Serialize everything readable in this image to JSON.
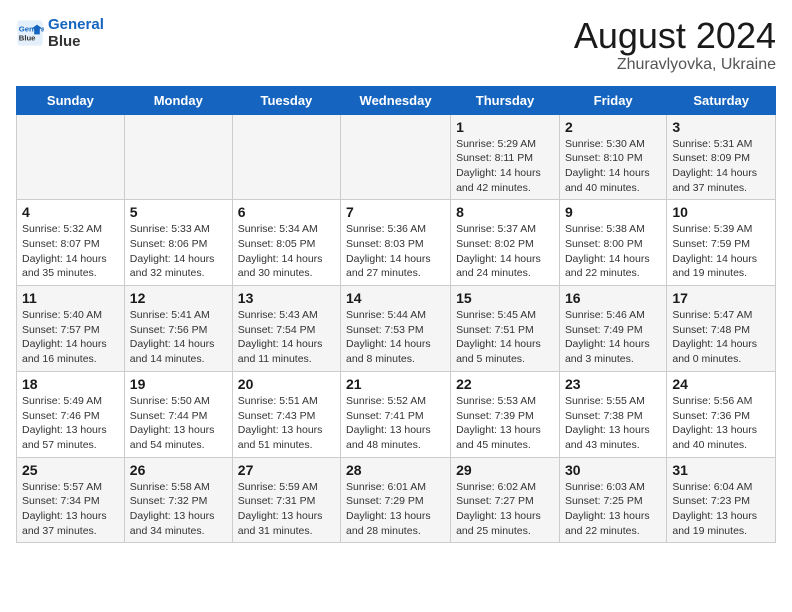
{
  "header": {
    "logo_line1": "General",
    "logo_line2": "Blue",
    "month": "August 2024",
    "location": "Zhuravlyovka, Ukraine"
  },
  "weekdays": [
    "Sunday",
    "Monday",
    "Tuesday",
    "Wednesday",
    "Thursday",
    "Friday",
    "Saturday"
  ],
  "weeks": [
    [
      {
        "day": "",
        "info": ""
      },
      {
        "day": "",
        "info": ""
      },
      {
        "day": "",
        "info": ""
      },
      {
        "day": "",
        "info": ""
      },
      {
        "day": "1",
        "info": "Sunrise: 5:29 AM\nSunset: 8:11 PM\nDaylight: 14 hours\nand 42 minutes."
      },
      {
        "day": "2",
        "info": "Sunrise: 5:30 AM\nSunset: 8:10 PM\nDaylight: 14 hours\nand 40 minutes."
      },
      {
        "day": "3",
        "info": "Sunrise: 5:31 AM\nSunset: 8:09 PM\nDaylight: 14 hours\nand 37 minutes."
      }
    ],
    [
      {
        "day": "4",
        "info": "Sunrise: 5:32 AM\nSunset: 8:07 PM\nDaylight: 14 hours\nand 35 minutes."
      },
      {
        "day": "5",
        "info": "Sunrise: 5:33 AM\nSunset: 8:06 PM\nDaylight: 14 hours\nand 32 minutes."
      },
      {
        "day": "6",
        "info": "Sunrise: 5:34 AM\nSunset: 8:05 PM\nDaylight: 14 hours\nand 30 minutes."
      },
      {
        "day": "7",
        "info": "Sunrise: 5:36 AM\nSunset: 8:03 PM\nDaylight: 14 hours\nand 27 minutes."
      },
      {
        "day": "8",
        "info": "Sunrise: 5:37 AM\nSunset: 8:02 PM\nDaylight: 14 hours\nand 24 minutes."
      },
      {
        "day": "9",
        "info": "Sunrise: 5:38 AM\nSunset: 8:00 PM\nDaylight: 14 hours\nand 22 minutes."
      },
      {
        "day": "10",
        "info": "Sunrise: 5:39 AM\nSunset: 7:59 PM\nDaylight: 14 hours\nand 19 minutes."
      }
    ],
    [
      {
        "day": "11",
        "info": "Sunrise: 5:40 AM\nSunset: 7:57 PM\nDaylight: 14 hours\nand 16 minutes."
      },
      {
        "day": "12",
        "info": "Sunrise: 5:41 AM\nSunset: 7:56 PM\nDaylight: 14 hours\nand 14 minutes."
      },
      {
        "day": "13",
        "info": "Sunrise: 5:43 AM\nSunset: 7:54 PM\nDaylight: 14 hours\nand 11 minutes."
      },
      {
        "day": "14",
        "info": "Sunrise: 5:44 AM\nSunset: 7:53 PM\nDaylight: 14 hours\nand 8 minutes."
      },
      {
        "day": "15",
        "info": "Sunrise: 5:45 AM\nSunset: 7:51 PM\nDaylight: 14 hours\nand 5 minutes."
      },
      {
        "day": "16",
        "info": "Sunrise: 5:46 AM\nSunset: 7:49 PM\nDaylight: 14 hours\nand 3 minutes."
      },
      {
        "day": "17",
        "info": "Sunrise: 5:47 AM\nSunset: 7:48 PM\nDaylight: 14 hours\nand 0 minutes."
      }
    ],
    [
      {
        "day": "18",
        "info": "Sunrise: 5:49 AM\nSunset: 7:46 PM\nDaylight: 13 hours\nand 57 minutes."
      },
      {
        "day": "19",
        "info": "Sunrise: 5:50 AM\nSunset: 7:44 PM\nDaylight: 13 hours\nand 54 minutes."
      },
      {
        "day": "20",
        "info": "Sunrise: 5:51 AM\nSunset: 7:43 PM\nDaylight: 13 hours\nand 51 minutes."
      },
      {
        "day": "21",
        "info": "Sunrise: 5:52 AM\nSunset: 7:41 PM\nDaylight: 13 hours\nand 48 minutes."
      },
      {
        "day": "22",
        "info": "Sunrise: 5:53 AM\nSunset: 7:39 PM\nDaylight: 13 hours\nand 45 minutes."
      },
      {
        "day": "23",
        "info": "Sunrise: 5:55 AM\nSunset: 7:38 PM\nDaylight: 13 hours\nand 43 minutes."
      },
      {
        "day": "24",
        "info": "Sunrise: 5:56 AM\nSunset: 7:36 PM\nDaylight: 13 hours\nand 40 minutes."
      }
    ],
    [
      {
        "day": "25",
        "info": "Sunrise: 5:57 AM\nSunset: 7:34 PM\nDaylight: 13 hours\nand 37 minutes."
      },
      {
        "day": "26",
        "info": "Sunrise: 5:58 AM\nSunset: 7:32 PM\nDaylight: 13 hours\nand 34 minutes."
      },
      {
        "day": "27",
        "info": "Sunrise: 5:59 AM\nSunset: 7:31 PM\nDaylight: 13 hours\nand 31 minutes."
      },
      {
        "day": "28",
        "info": "Sunrise: 6:01 AM\nSunset: 7:29 PM\nDaylight: 13 hours\nand 28 minutes."
      },
      {
        "day": "29",
        "info": "Sunrise: 6:02 AM\nSunset: 7:27 PM\nDaylight: 13 hours\nand 25 minutes."
      },
      {
        "day": "30",
        "info": "Sunrise: 6:03 AM\nSunset: 7:25 PM\nDaylight: 13 hours\nand 22 minutes."
      },
      {
        "day": "31",
        "info": "Sunrise: 6:04 AM\nSunset: 7:23 PM\nDaylight: 13 hours\nand 19 minutes."
      }
    ]
  ]
}
